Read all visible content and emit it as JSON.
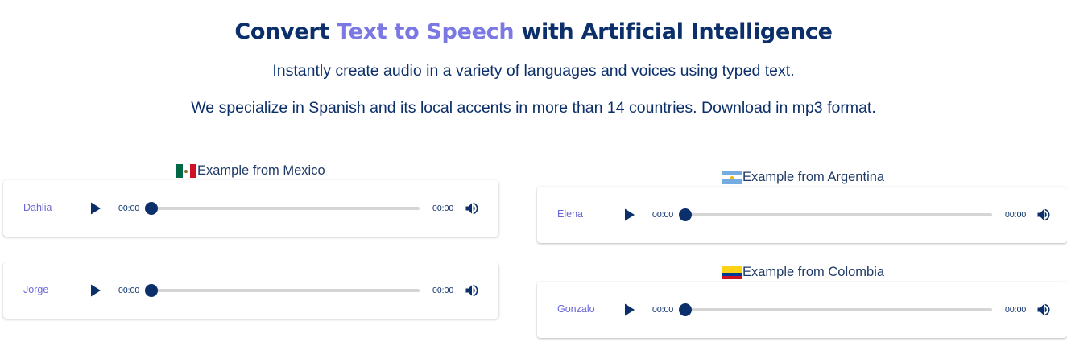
{
  "header": {
    "title_part1": "Convert ",
    "title_highlight": "Text to Speech",
    "title_part2": " with Artificial Intelligence",
    "subtitle1": "Instantly create audio in a variety of languages and voices using typed text.",
    "subtitle2": "We specialize in Spanish and its local accents in more than 14 countries. Download in mp3 format."
  },
  "colors": {
    "navy": "#0b2f6a",
    "accent": "#7b78e3",
    "track": "#d5d5d5"
  },
  "sections": {
    "mexico": {
      "label": "Example from Mexico",
      "flag": "mexico-flag",
      "players": [
        {
          "voice": "Dahlia",
          "current_time": "00:00",
          "duration": "00:00",
          "progress": 0
        },
        {
          "voice": "Jorge",
          "current_time": "00:00",
          "duration": "00:00",
          "progress": 0
        }
      ]
    },
    "argentina": {
      "label": "Example from Argentina",
      "flag": "argentina-flag",
      "players": [
        {
          "voice": "Elena",
          "current_time": "00:00",
          "duration": "00:00",
          "progress": 0
        }
      ]
    },
    "colombia": {
      "label": "Example from Colombia",
      "flag": "colombia-flag",
      "players": [
        {
          "voice": "Gonzalo",
          "current_time": "00:00",
          "duration": "00:00",
          "progress": 0
        }
      ]
    }
  },
  "icons": {
    "play": "play-icon",
    "volume": "volume-icon"
  }
}
